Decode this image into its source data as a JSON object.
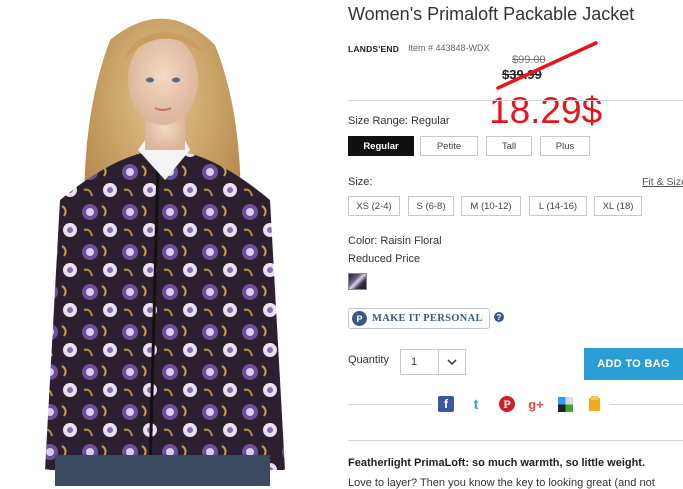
{
  "product": {
    "title": "Women's Primaloft Packable Jacket",
    "brand": "LANDS'END",
    "item_number": "Item # 443848-WDX",
    "original_price": "$99.00",
    "current_price": "$39.99",
    "sale_annotation": "18.29$"
  },
  "size_range": {
    "label": "Size Range: Regular",
    "options": [
      "Regular",
      "Petite",
      "Tall",
      "Plus"
    ],
    "selected": "Regular"
  },
  "size": {
    "label": "Size:",
    "guide_link": "Fit & Size",
    "options": [
      "XS (2-4)",
      "S (6-8)",
      "M (10-12)",
      "L (14-16)",
      "XL (18)"
    ]
  },
  "color": {
    "label": "Color: Raisin Floral",
    "note": "Reduced Price"
  },
  "personalize": {
    "badge": "P",
    "label": "MAKE IT PERSONAL",
    "help": "?"
  },
  "quantity": {
    "label": "Quantity",
    "value": "1"
  },
  "add_to_bag": "ADD TO BAG",
  "social": {
    "icons": [
      "facebook-icon",
      "twitter-icon",
      "pinterest-icon",
      "google-plus-icon",
      "delicious-icon",
      "save-icon"
    ],
    "glyphs": [
      "f",
      "t",
      "P",
      "g+",
      "",
      ""
    ]
  },
  "description": {
    "headline": "Featherlight PrimaLoft: so much warmth, so little weight.",
    "text": "Love to layer? Then you know the key to looking great (and not"
  },
  "colors": {
    "sale_red": "#e8141a",
    "cta_blue": "#2a9fd6",
    "brand_blue": "#3a5a86"
  }
}
